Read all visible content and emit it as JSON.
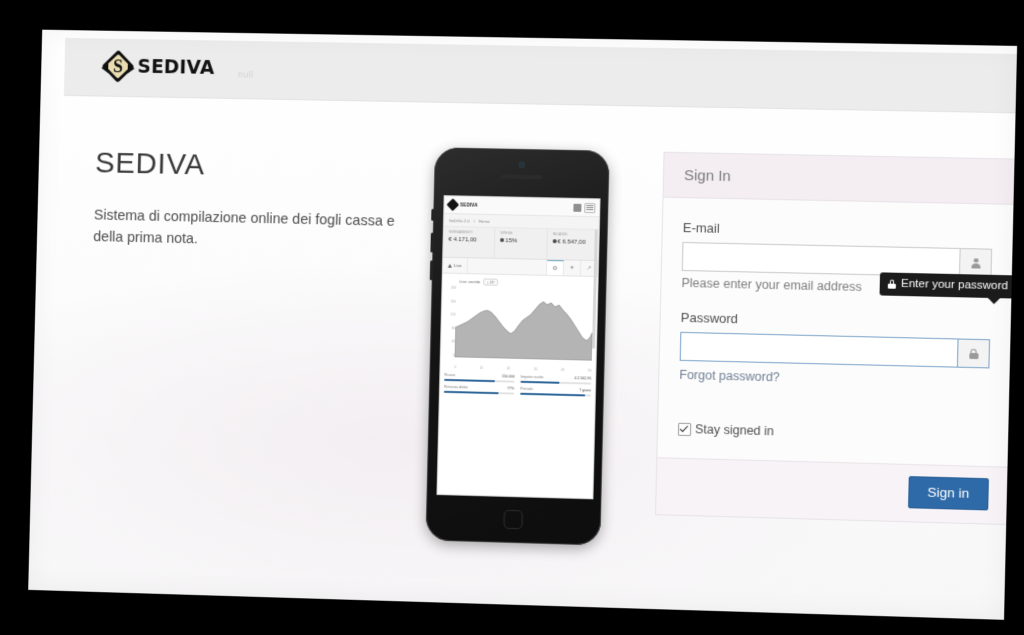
{
  "appbar": {
    "brand_name": "SEDIVA",
    "ghost_label": "null"
  },
  "hero": {
    "title": "SEDIVA",
    "subtitle": "Sistema di compilazione online dei fogli cassa e della prima nota."
  },
  "phone": {
    "app": {
      "logo_text": "SEDIVA",
      "breadcrumb": [
        "SeDiVa 2.0",
        "Home"
      ],
      "stats": [
        {
          "label": "VERSAMENTI",
          "value": "€ 4.171,00",
          "icon": ""
        },
        {
          "label": "SPESE",
          "value": "15%",
          "icon": "clock-icon"
        },
        {
          "label": "INCASSI",
          "value": "€ 6.547,00",
          "icon": "cart-icon"
        }
      ],
      "tabs": {
        "primary": "Live",
        "icons": [
          "gear-icon",
          "star-icon",
          "arrow-icon"
        ]
      },
      "chart": {
        "title": "Live ventite",
        "pill": "+ 18°",
        "y_ticks": [
          "200",
          "160",
          "120",
          "80",
          "40",
          "0"
        ],
        "x_ticks": [
          "0",
          "10",
          "20",
          "30",
          "40",
          "50"
        ]
      },
      "metrics": [
        {
          "label": "Ricavo",
          "value": "150.000",
          "pct": 72
        },
        {
          "label": "Importo ricette",
          "value": "4.2.562,95",
          "pct": 55
        },
        {
          "label": "Rimanza diritto",
          "value": "77%",
          "pct": 77
        },
        {
          "label": "Periodo",
          "value": "7 giorni",
          "pct": 92
        }
      ]
    }
  },
  "signin": {
    "header": "Sign In",
    "email": {
      "label": "E-mail",
      "value": "",
      "placeholder": "",
      "addon_icon": "user-icon",
      "help": "Please enter your email address"
    },
    "password": {
      "label": "Password",
      "value": "",
      "placeholder": "",
      "addon_icon": "lock-icon",
      "forgot_link": "Forgot password?"
    },
    "stay_signed_in": {
      "label": "Stay signed in",
      "checked": true
    },
    "submit_label": "Sign in",
    "tooltip": {
      "text": "Enter your password",
      "icon": "lock-icon"
    },
    "colors": {
      "header_bg": "#f4eef2",
      "footer_bg": "#f7f3f6",
      "primary_button": "#2f6aa8",
      "focus_border": "#7ba2c9",
      "tooltip_bg": "#1b1b1b"
    }
  }
}
